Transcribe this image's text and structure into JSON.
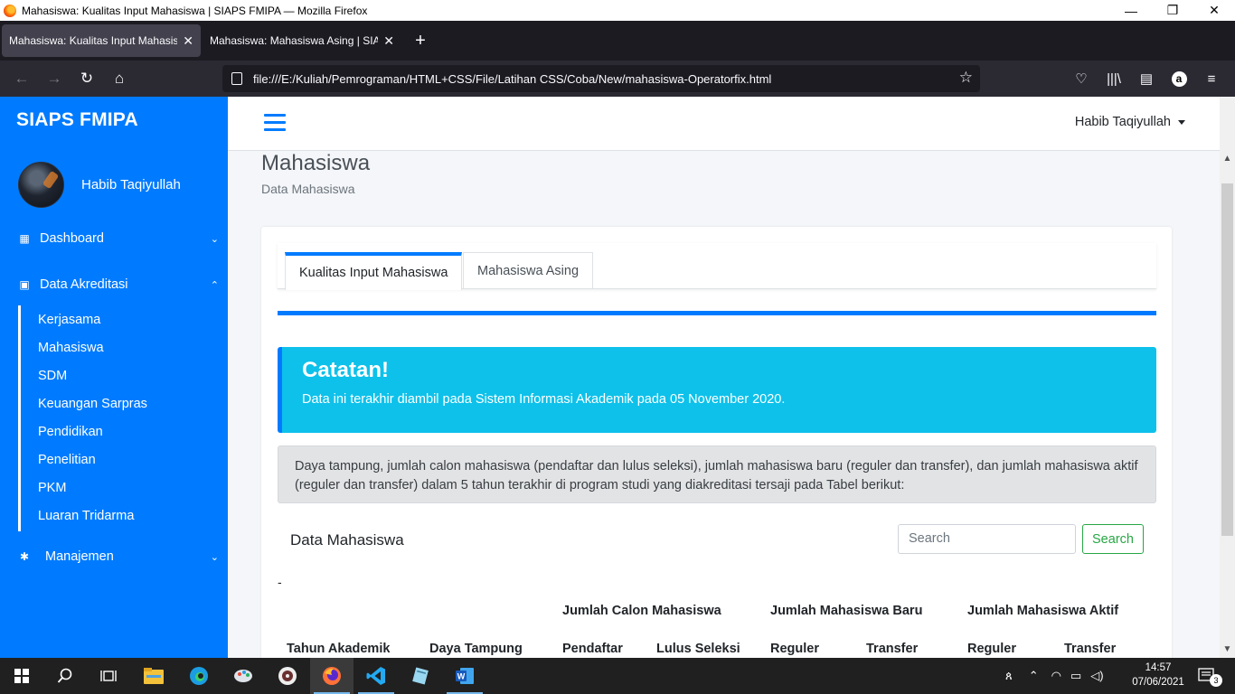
{
  "window": {
    "title": "Mahasiswa: Kualitas Input Mahasiswa | SIAPS FMIPA — Mozilla Firefox",
    "minimize": "—",
    "restore": "❐",
    "close": "✕"
  },
  "tabs": [
    {
      "label": "Mahasiswa: Kualitas Input Mahasisw",
      "close": "✕"
    },
    {
      "label": "Mahasiswa: Mahasiswa Asing | SIAP",
      "close": "✕"
    }
  ],
  "new_tab": "+",
  "toolbar": {
    "url": "file:///E:/Kuliah/Pemrograman/HTML+CSS/File/Latihan CSS/Coba/New/mahasiswa-Operatorfix.html",
    "back": "←",
    "forward": "→",
    "reload": "↻",
    "home": "⌂",
    "star": "☆",
    "pocket": "♡",
    "library": "|||\\",
    "sidebar": "▤",
    "amazon": "a",
    "menu": "≡"
  },
  "sidebar": {
    "brand": "SIAPS FMIPA",
    "user_name": "Habib Taqiyullah",
    "menu": [
      {
        "label": "Dashboard",
        "icon": "grid-icon",
        "icon_glyph": "▦",
        "chevron": "⌄"
      },
      {
        "label": "Data Akreditasi",
        "icon": "calendar-icon",
        "icon_glyph": "▣",
        "chevron": "⌃"
      },
      {
        "label": "Manajemen",
        "icon": "gear-icon",
        "icon_glyph": "✱",
        "chevron": "⌄"
      }
    ],
    "submenu": [
      "Kerjasama",
      "Mahasiswa",
      "SDM",
      "Keuangan Sarpras",
      "Pendidikan",
      "Penelitian",
      "PKM",
      "Luaran Tridarma"
    ]
  },
  "topnav": {
    "user_name": "Habib Taqiyullah"
  },
  "page": {
    "title": "Mahasiswa",
    "subtitle": "Data Mahasiswa"
  },
  "content_tabs": [
    "Kualitas Input Mahasiswa",
    "Mahasiswa Asing"
  ],
  "callout": {
    "title": "Catatan!",
    "text": "Data ini terakhir diambil pada Sistem Informasi Akademik pada 05 November 2020."
  },
  "info_text": "Daya tampung, jumlah calon mahasiswa (pendaftar dan lulus seleksi), jumlah mahasiswa baru (reguler dan transfer), dan jumlah mahasiswa aktif (reguler dan transfer) dalam 5 tahun terakhir di program studi yang diakreditasi tersaji pada Tabel berikut:",
  "data_section": {
    "title": "Data Mahasiswa",
    "search_placeholder": "Search",
    "search_button": "Search",
    "dash": "-"
  },
  "table": {
    "group_headers": [
      "Jumlah Calon Mahasiswa",
      "Jumlah Mahasiswa Baru",
      "Jumlah Mahasiswa Aktif"
    ],
    "columns": [
      "Tahun Akademik",
      "Daya Tampung",
      "Pendaftar",
      "Lulus Seleksi",
      "Reguler",
      "Transfer",
      "Reguler",
      "Transfer"
    ]
  },
  "taskbar": {
    "time": "14:57",
    "date": "07/06/2021",
    "notifications": "3"
  }
}
